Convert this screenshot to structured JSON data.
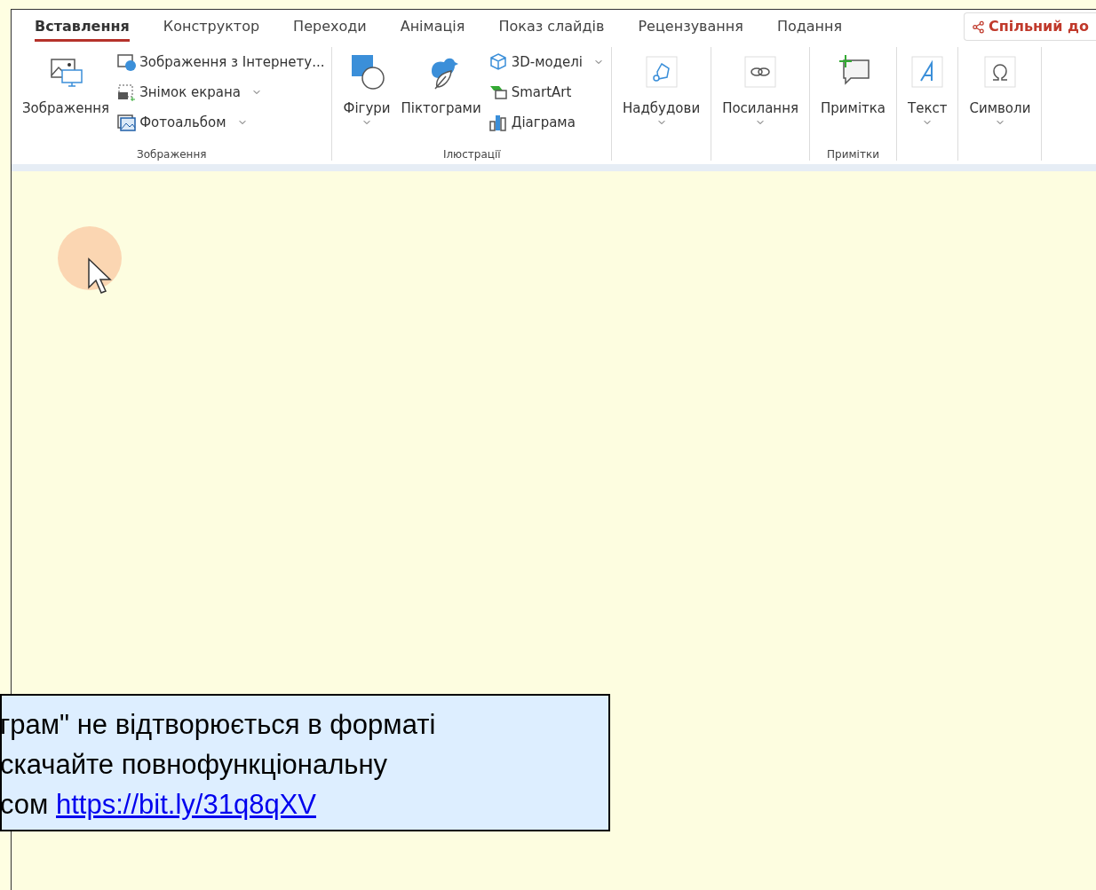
{
  "ribbon": {
    "tabs": [
      {
        "label": "Вставлення",
        "selected": true
      },
      {
        "label": "Конструктор",
        "selected": false
      },
      {
        "label": "Переходи",
        "selected": false
      },
      {
        "label": "Анімація",
        "selected": false
      },
      {
        "label": "Показ слайдів",
        "selected": false
      },
      {
        "label": "Рецензування",
        "selected": false
      },
      {
        "label": "Подання",
        "selected": false
      }
    ],
    "share_button": "Спільний до",
    "groups": [
      {
        "label": "Зображення",
        "items": [
          {
            "kind": "large",
            "label": "Зображення",
            "dropdown": false
          },
          {
            "kind": "small",
            "label": "Зображення з Інтернету...",
            "dropdown": false
          },
          {
            "kind": "small",
            "label": "Знімок екрана",
            "dropdown": true
          },
          {
            "kind": "small",
            "label": "Фотоальбом",
            "dropdown": true
          }
        ]
      },
      {
        "label": "Ілюстрації",
        "items": [
          {
            "kind": "large",
            "label": "Фігури",
            "dropdown": true
          },
          {
            "kind": "large",
            "label": "Піктограми",
            "dropdown": false
          },
          {
            "kind": "small",
            "label": "3D-моделі",
            "dropdown": true
          },
          {
            "kind": "small",
            "label": "SmartArt",
            "dropdown": false
          },
          {
            "kind": "small",
            "label": "Діаграма",
            "dropdown": false
          }
        ]
      },
      {
        "items": [
          {
            "kind": "large",
            "label": "Надбудови",
            "dropdown": true
          }
        ]
      },
      {
        "items": [
          {
            "kind": "large",
            "label": "Посилання",
            "dropdown": true
          }
        ]
      },
      {
        "label": "Примітки",
        "items": [
          {
            "kind": "large",
            "label": "Примітка",
            "dropdown": false
          }
        ]
      },
      {
        "items": [
          {
            "kind": "large",
            "label": "Текст",
            "dropdown": true
          }
        ]
      },
      {
        "items": [
          {
            "kind": "large",
            "label": "Символи",
            "dropdown": true
          }
        ]
      }
    ]
  },
  "notice": {
    "lines": [
      "грам\" не відтворюється в форматі",
      "скачайте повнофункціональну",
      "сом "
    ],
    "link": "https://bit.ly/31q8qXV"
  }
}
